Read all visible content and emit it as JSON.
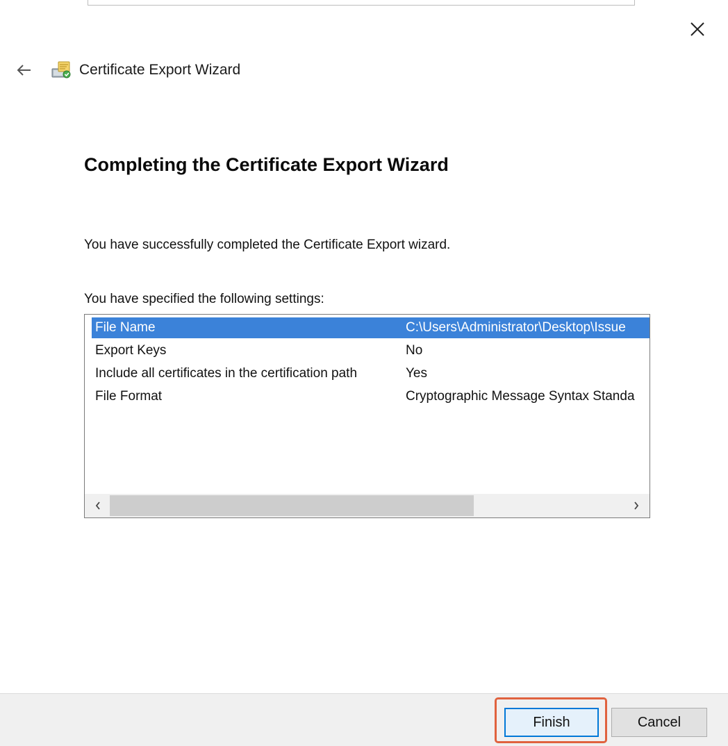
{
  "wizard": {
    "title": "Certificate Export Wizard"
  },
  "page": {
    "heading": "Completing the Certificate Export Wizard",
    "message": "You have successfully completed the Certificate Export wizard.",
    "settings_label": "You have specified the following settings:"
  },
  "settings": [
    {
      "key": "File Name",
      "value": "C:\\Users\\Administrator\\Desktop\\Issue"
    },
    {
      "key": "Export Keys",
      "value": "No"
    },
    {
      "key": "Include all certificates in the certification path",
      "value": "Yes"
    },
    {
      "key": "File Format",
      "value": "Cryptographic Message Syntax Standa"
    }
  ],
  "selected_row": 0,
  "scrollbar": {
    "left_arrow": "‹",
    "right_arrow": "›"
  },
  "buttons": {
    "finish": "Finish",
    "cancel": "Cancel"
  },
  "colors": {
    "selection": "#3b82d9",
    "highlight": "#e0623e",
    "default_button_border": "#0078d7"
  },
  "icons": {
    "close": "close-icon",
    "back": "back-arrow-icon",
    "wizard": "certificate-wizard-icon"
  }
}
